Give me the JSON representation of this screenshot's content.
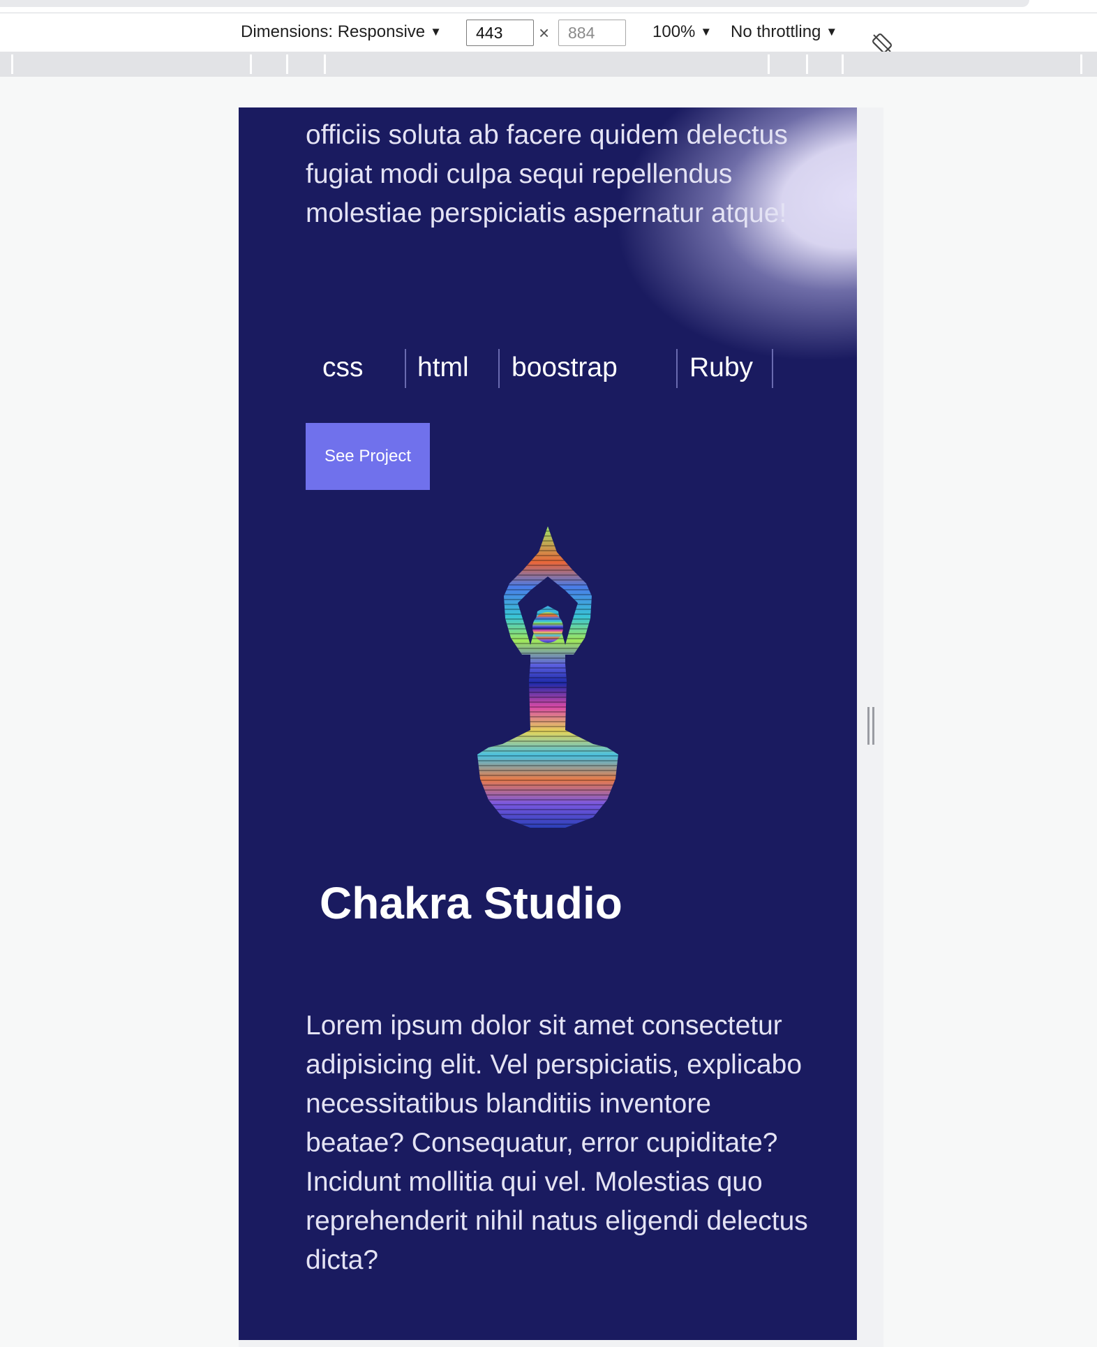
{
  "devtools": {
    "dimensions_label": "Dimensions: Responsive",
    "width_value": "443",
    "height_placeholder": "884",
    "zoom_label": "100%",
    "throttling_label": "No throttling"
  },
  "project_prev": {
    "description": "officiis soluta ab facere quidem delectus fugiat modi culpa sequi repellendus molestiae perspiciatis aspernatur atque!",
    "tags": [
      "css",
      "html",
      "boostrap",
      "Ruby"
    ],
    "button_label": "See Project"
  },
  "project": {
    "title": "Chakra Studio",
    "description": "Lorem ipsum dolor sit amet consectetur adipisicing elit. Vel perspiciatis, explicabo necessitatibus blanditiis inventore beatae? Consequatur, error cupiditate? Incidunt mollitia qui vel. Molestias quo reprehenderit nihil natus eligendi delectus dicta?",
    "image_icon": "yoga-meditation-icon"
  },
  "colors": {
    "page_bg": "#1a1b60",
    "button_bg": "#7071ec",
    "text": "#e4e3f4"
  }
}
